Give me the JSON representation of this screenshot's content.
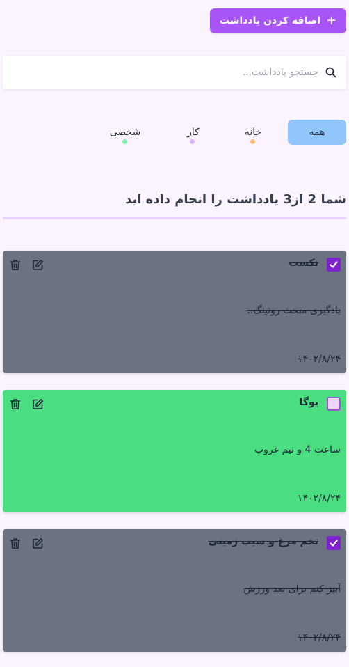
{
  "header": {
    "add_note_label": "اضافه کردن یادداشت",
    "add_icon": "plus-icon"
  },
  "search": {
    "placeholder": "جستجو یادداشت...",
    "value": "",
    "icon": "search-icon"
  },
  "filters": [
    {
      "label": "همه",
      "active": true
    },
    {
      "label": "خانه",
      "dot_color": "#fdba74"
    },
    {
      "label": "کار",
      "dot_color": "#d8b4fe"
    },
    {
      "label": "شخصی",
      "dot_color": "#86efac"
    }
  ],
  "summary": "شما 2 از3 یادداشت را انجام داده اید",
  "notes": [
    {
      "title": "نکست",
      "body": "یادگیری مبحث روتینگ..",
      "date": "۱۴۰۲/۸/۲۴",
      "completed": true,
      "color": "#6b7280"
    },
    {
      "title": "یوگا",
      "body": "ساعت 4 و نیم غروب",
      "date": "۱۴۰۲/۸/۲۴",
      "completed": false,
      "color": "#4ade80"
    },
    {
      "title": "تخم مرغ و سیب زمینی",
      "body": "آبپز کنم برای بعد ورزش",
      "date": "۱۴۰۲/۸/۲۴",
      "completed": true,
      "color": "#6b7280"
    }
  ],
  "icons": {
    "edit": "edit-icon",
    "delete": "trash-icon",
    "check": "check-icon"
  }
}
